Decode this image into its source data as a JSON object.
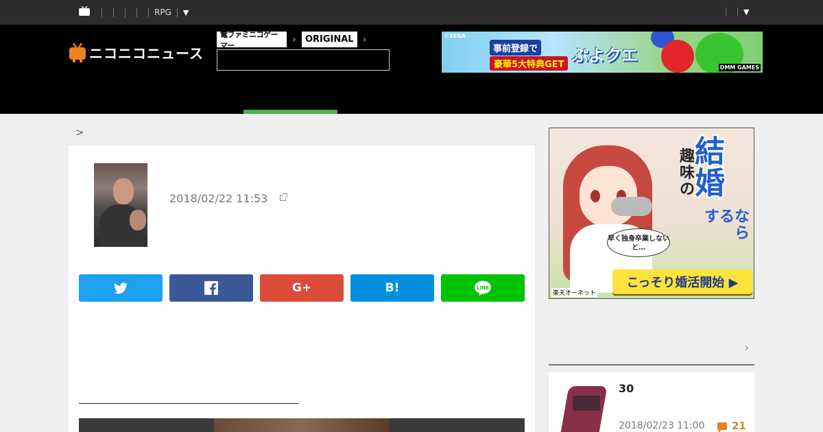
{
  "topbar": {
    "nav_label": "RPG",
    "dropdown_caret": "▼",
    "right_caret": "▼"
  },
  "header": {
    "logo_text": "ニコニコニュース",
    "brand_dengeki": "電ファミニコゲーマー",
    "brand_original": "ORIGINAL",
    "brand_arrow": "›",
    "search_placeholder": "",
    "top_banner": {
      "sega": "©SEGA",
      "register": "事前登録で",
      "get": "豪華5大特典GET",
      "title": "ぷよクエ",
      "dmm": "DMM GAMES"
    }
  },
  "breadcrumb": {
    "text": ">"
  },
  "article": {
    "date": "2018/02/22 11:53",
    "share": {
      "twitter": "twitter-icon",
      "facebook": "f",
      "google": "G+",
      "hatena": "B!",
      "line": "LINE"
    },
    "body": "　　　　　　　　　　　　　　　　　　　　　　　　　　　　　　　　　　　　　　　　　　　　　　　　　　　　　　　　　　　　　　　　　　　　　　　　　　　　　　　　　　　　　　　　　　　　　",
    "related_link": "　　　　　　　　　　　　　　　　　　　　"
  },
  "sidebar": {
    "ad": {
      "headline_main": "結婚",
      "headline_small": "趣味の",
      "headline_sub": "するなら",
      "bubble": "早く独身卒業しないと…",
      "cta": "こっそり婚活開始 ▶",
      "sponsor": "楽天オーネット"
    },
    "section_chevron": "›",
    "rank_item": {
      "title": "30",
      "date": "2018/02/23 11:00",
      "comments": "21"
    }
  },
  "colors": {
    "twitter": "#1da1f2",
    "facebook": "#3b5998",
    "google": "#dd4b39",
    "hatena": "#008fde",
    "line": "#00c300",
    "accent_green": "#4caf50",
    "comment_orange": "#e67e22"
  }
}
